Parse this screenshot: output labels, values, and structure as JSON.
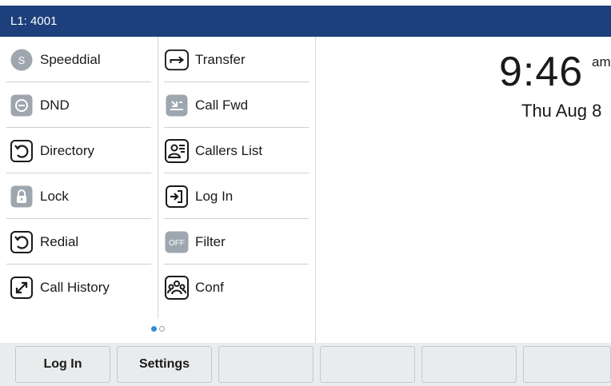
{
  "header": {
    "line_label": "L1: 4001"
  },
  "left_keys": [
    {
      "label": "Speeddial",
      "icon": "speeddial-s-icon",
      "badge": "S"
    },
    {
      "label": "DND",
      "icon": "dnd-icon"
    },
    {
      "label": "Directory",
      "icon": "directory-icon"
    },
    {
      "label": "Lock",
      "icon": "lock-icon"
    },
    {
      "label": "Redial",
      "icon": "redial-icon"
    },
    {
      "label": "Call History",
      "icon": "call-history-icon"
    }
  ],
  "right_keys": [
    {
      "label": "Transfer",
      "icon": "transfer-arrow-icon"
    },
    {
      "label": "Call Fwd",
      "icon": "call-forward-icon"
    },
    {
      "label": "Callers List",
      "icon": "callers-list-icon"
    },
    {
      "label": "Log In",
      "icon": "login-icon"
    },
    {
      "label": "Filter",
      "icon": "filter-off-icon",
      "badge": "OFF"
    },
    {
      "label": "Conf",
      "icon": "conference-icon"
    }
  ],
  "pager": {
    "pages": 2,
    "current": 1
  },
  "clock": {
    "time": "9:46",
    "ampm": "am",
    "date": "Thu Aug 8"
  },
  "softkeys": [
    {
      "label": "Log In"
    },
    {
      "label": "Settings"
    },
    {
      "label": ""
    },
    {
      "label": ""
    },
    {
      "label": ""
    },
    {
      "label": ""
    }
  ],
  "colors": {
    "header_bg": "#1d3f7c",
    "accent_dot": "#2e8fd6",
    "softkey_bg": "#e9ebed"
  }
}
